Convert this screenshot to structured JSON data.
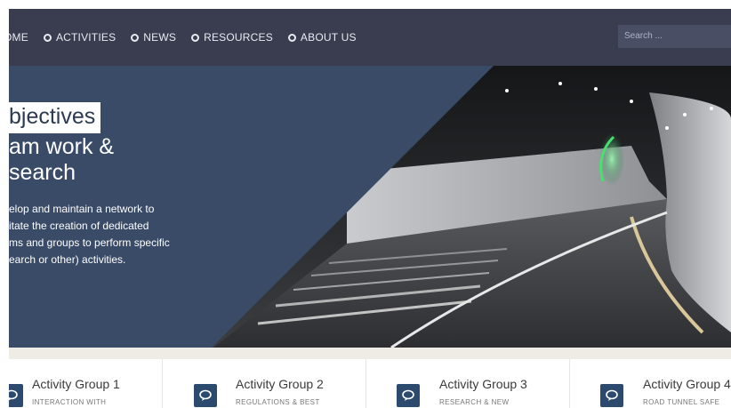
{
  "nav": {
    "items": [
      {
        "label": "OME"
      },
      {
        "label": "ACTIVITIES"
      },
      {
        "label": "NEWS"
      },
      {
        "label": "RESOURCES"
      },
      {
        "label": "ABOUT US"
      }
    ],
    "search_placeholder": "Search ..."
  },
  "hero": {
    "title": "bjectives",
    "subtitle_line1": "am work &",
    "subtitle_line2": "search",
    "desc_line1": "elop and maintain a network to",
    "desc_line2": "itate the creation of dedicated",
    "desc_line3": "ms and groups to perform specific",
    "desc_line4": "earch or other) activities."
  },
  "groups": [
    {
      "title": "Activity Group 1",
      "sub": "INTERACTION WITH"
    },
    {
      "title": "Activity Group 2",
      "sub": "REGULATIONS & BEST"
    },
    {
      "title": "Activity Group 3",
      "sub": "RESEARCH & NEW"
    },
    {
      "title": "Activity Group 4",
      "sub": "ROAD TUNNEL SAFE"
    }
  ],
  "colors": {
    "nav_bg": "#3a3d50",
    "hero_panel": "#3a4b68",
    "icon_bg": "#2c4a6e",
    "band": "#efece6"
  }
}
